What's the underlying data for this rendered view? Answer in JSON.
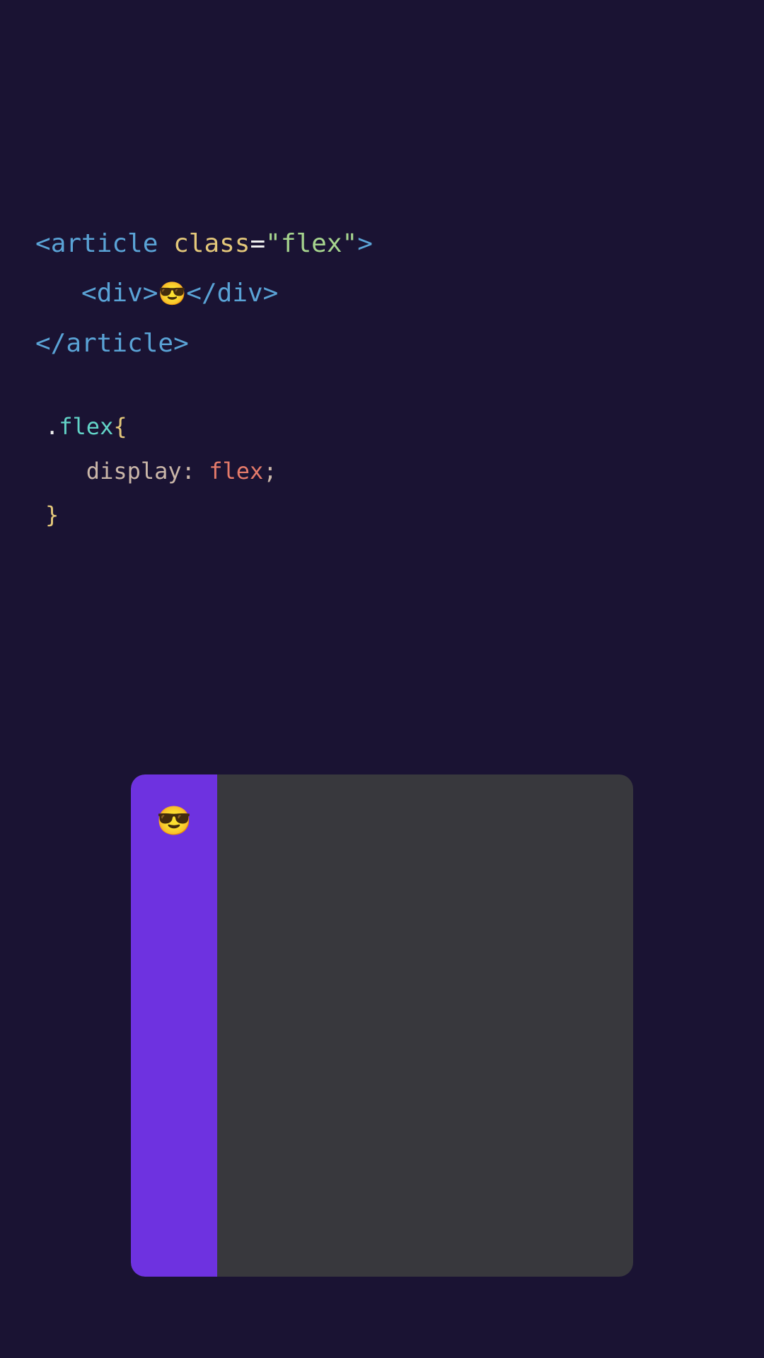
{
  "code": {
    "html": {
      "line1": {
        "open": "<",
        "tag": "article",
        "space": " ",
        "attr": "class",
        "eq": "=",
        "val": "\"flex\"",
        "close": ">"
      },
      "line2": {
        "indent": "   ",
        "open1": "<",
        "tag1": "div",
        "close1": ">",
        "emoji": "😎",
        "open2": "</",
        "tag2": "div",
        "close2": ">"
      },
      "line3": {
        "open": "</",
        "tag": "article",
        "close": ">"
      }
    },
    "css": {
      "line1": {
        "dot": ".",
        "name": "flex",
        "brace": "{"
      },
      "line2": {
        "indent": "   ",
        "prop": "display",
        "colon": ":",
        "space": " ",
        "value": "flex",
        "semi": ";"
      },
      "line3": {
        "brace": "}"
      }
    }
  },
  "preview": {
    "emoji": "😎"
  }
}
